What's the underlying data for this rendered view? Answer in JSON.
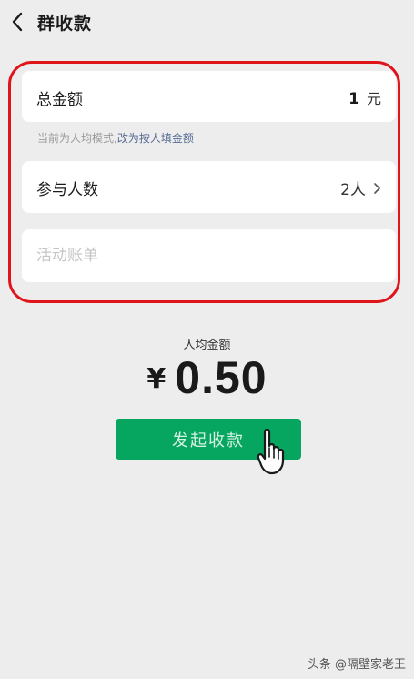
{
  "header": {
    "title": "群收款"
  },
  "form": {
    "total_label": "总金额",
    "total_value": "1",
    "total_unit": "元",
    "hint_prefix": "当前为人均模式",
    "hint_separator": ",",
    "hint_link": "改为按人填金额",
    "people_label": "参与人数",
    "people_value": "2人",
    "bill_placeholder": "活动账单"
  },
  "summary": {
    "avg_label": "人均金额",
    "currency": "¥",
    "avg_value": "0.50"
  },
  "action": {
    "collect_label": "发起收款"
  },
  "watermark": {
    "text": "头条 @隔壁家老王"
  },
  "colors": {
    "highlight": "#e0151b",
    "button": "#07a660",
    "link": "#576b95"
  },
  "icons": {
    "back": "chevron-left-icon",
    "people_arrow": "chevron-right-icon",
    "cursor": "hand-pointer-icon"
  }
}
